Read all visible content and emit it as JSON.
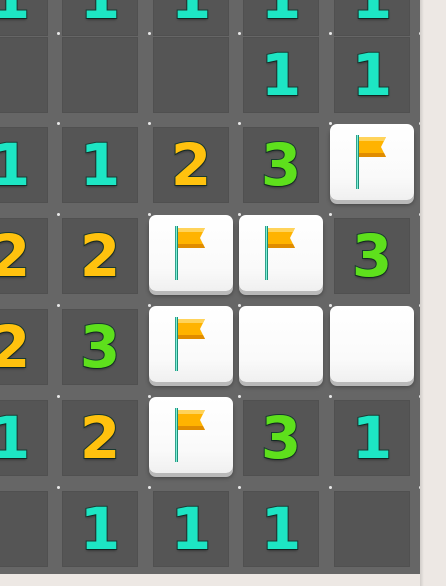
{
  "board": {
    "grid": [
      [
        {
          "t": "n",
          "v": "1"
        },
        {
          "t": "n",
          "v": "1"
        },
        {
          "t": "n",
          "v": "1"
        },
        {
          "t": "n",
          "v": "1"
        },
        {
          "t": "n",
          "v": "1"
        }
      ],
      [
        {
          "t": "e"
        },
        {
          "t": "e"
        },
        {
          "t": "e"
        },
        {
          "t": "n",
          "v": "1"
        },
        {
          "t": "n",
          "v": "1"
        }
      ],
      [
        {
          "t": "n",
          "v": "1"
        },
        {
          "t": "n",
          "v": "1"
        },
        {
          "t": "n",
          "v": "2"
        },
        {
          "t": "n",
          "v": "3"
        },
        {
          "t": "f"
        }
      ],
      [
        {
          "t": "n",
          "v": "2"
        },
        {
          "t": "n",
          "v": "2"
        },
        {
          "t": "f"
        },
        {
          "t": "f"
        },
        {
          "t": "n",
          "v": "3"
        }
      ],
      [
        {
          "t": "n",
          "v": "2"
        },
        {
          "t": "n",
          "v": "3"
        },
        {
          "t": "f"
        },
        {
          "t": "c"
        },
        {
          "t": "c"
        }
      ],
      [
        {
          "t": "n",
          "v": "1"
        },
        {
          "t": "n",
          "v": "2"
        },
        {
          "t": "f"
        },
        {
          "t": "n",
          "v": "3"
        },
        {
          "t": "n",
          "v": "1"
        }
      ],
      [
        {
          "t": "e"
        },
        {
          "t": "n",
          "v": "1"
        },
        {
          "t": "n",
          "v": "1"
        },
        {
          "t": "n",
          "v": "1"
        },
        {
          "t": "e"
        }
      ]
    ],
    "number_colors": {
      "1": "#1de6c4",
      "2": "#ffc20e",
      "3": "#5ee01c"
    },
    "covered_color": "#ffffff",
    "revealed_color": "#555555",
    "flag_icon": "flag-icon",
    "flag_color": "#ffb300"
  }
}
